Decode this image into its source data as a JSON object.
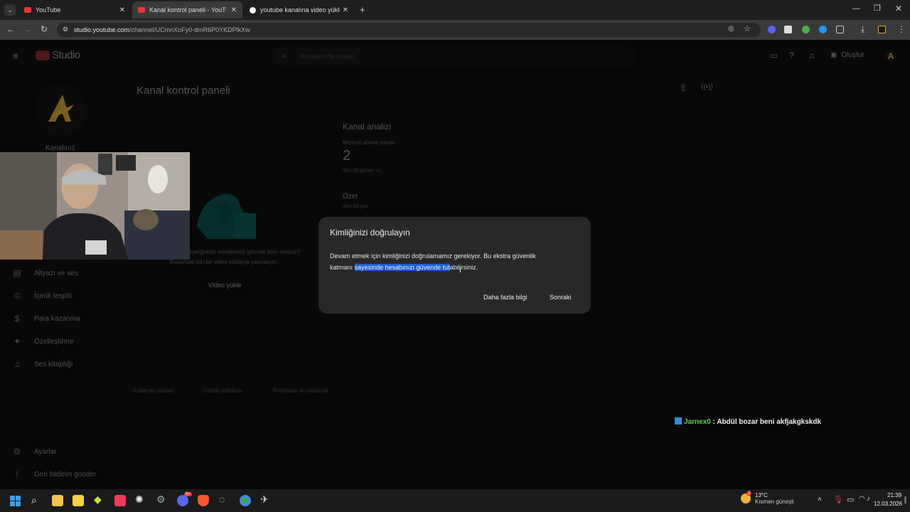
{
  "browser": {
    "tabs": [
      {
        "label": "YouTube"
      },
      {
        "label": "Kanal kontrol paneli - YouTube"
      },
      {
        "label": "youtube kanalına video yüklem"
      }
    ],
    "url_host": "studio.youtube.com",
    "url_path": "/channel/UCmnXoFy0-dmR6P0YKDPlkXw"
  },
  "studio": {
    "logo_text": "Studio",
    "search_placeholder": "Kanalınızda arayın",
    "create_label": "Oluştur",
    "page_title": "Kanal kontrol paneli",
    "channel_label": "Kanalınız",
    "upload_prompt_line1": "ı içeriğinizin metriklerini görmek ister misiniz?",
    "upload_prompt_line2": "Başlamak için bir video yükleyip yayınlayın",
    "upload_button": "Video yükle",
    "analytics": {
      "title": "Kanal analizi",
      "subs_label": "Mevcut abone sayısı",
      "subs_value": "2",
      "subs_delta": "Son 28 günde +1",
      "summary_title": "Özet",
      "summary_period": "Son 28 gün"
    },
    "sidebar": [
      {
        "label": "Altyazı ve ses",
        "icon": "subtitles-icon",
        "glyph": "▤"
      },
      {
        "label": "İçerik tespiti",
        "icon": "copyright-icon",
        "glyph": "©"
      },
      {
        "label": "Para kazanma",
        "icon": "dollar-icon",
        "glyph": "$"
      },
      {
        "label": "Özelleştirme",
        "icon": "magic-wand-icon",
        "glyph": "✦"
      },
      {
        "label": "Ses kitaplığı",
        "icon": "audio-library-icon",
        "glyph": "♫"
      }
    ],
    "sidebar_bottom": [
      {
        "label": "Ayarlar",
        "icon": "gear-icon",
        "glyph": "⚙"
      },
      {
        "label": "Geri bildirim gönder",
        "icon": "feedback-icon",
        "glyph": "!"
      }
    ],
    "footer": [
      "Kullanım şartları",
      "Gizlilik politikası",
      "Politikalar ve Güvenlik"
    ]
  },
  "dialog": {
    "title": "Kimliğinizi doğrulayın",
    "body_line1": "Devam etmek için kimliğinizi doğrulamamız gerekiyor. Bu ekstra güvenlik",
    "body_line2_pre": "katmanı ",
    "body_line2_selected": "sayesinde hesabınızı güvende tut",
    "body_line2_post": "abilirsiniz.",
    "learn_more": "Daha fazla bilgi",
    "next": "Sonraki"
  },
  "chat": {
    "user": "Jarnex0",
    "message": " : Abdül bozar beni akfjakgkskdk"
  },
  "taskbar": {
    "weather_temp": "13°C",
    "weather_desc": "Kısmen güneşli",
    "weather_badge": "2",
    "time": "21:39",
    "date": "12.03.2026",
    "discord_badge": "9+"
  },
  "colors": {
    "selection": "#1f5bd6",
    "chat_name": "#5ccf52",
    "logo_gold": "#e0b23a"
  }
}
